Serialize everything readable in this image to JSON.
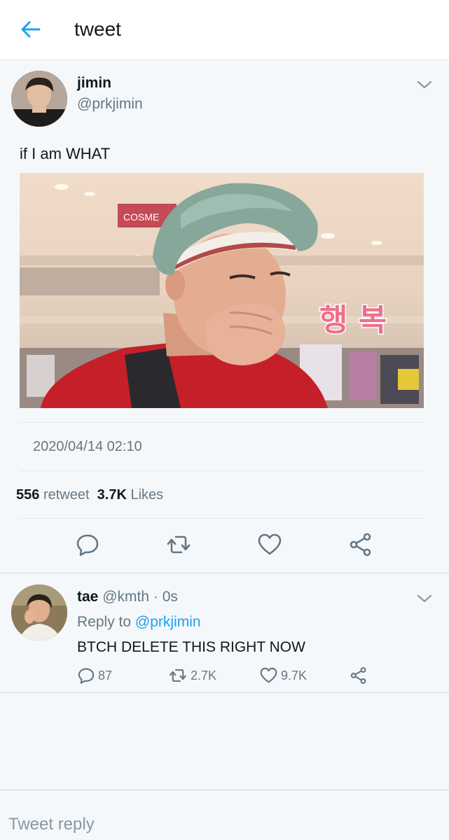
{
  "header": {
    "title": "tweet"
  },
  "tweet": {
    "display_name": "jimin",
    "handle": "@prkjimin",
    "text": "if I am WHAT",
    "media": {
      "sign_text": "COSME",
      "caption": "행 복"
    },
    "timestamp": "2020/04/14 02:10",
    "stats": {
      "retweets": "556",
      "retweets_label": "retweet",
      "likes": "3.7K",
      "likes_label": "Likes"
    }
  },
  "reply": {
    "display_name": "tae",
    "handle": "@kmth",
    "dot": "·",
    "time": "0s",
    "reply_to_label": "Reply to",
    "reply_to_handle": "@prkjimin",
    "text": "BTCH DELETE THIS RIGHT NOW",
    "counts": {
      "replies": "87",
      "retweets": "2.7K",
      "likes": "9.7K"
    }
  },
  "composer": {
    "placeholder": "Tweet reply"
  },
  "colors": {
    "accent": "#1da1f2",
    "secondary_text": "#657786",
    "text": "#14171a",
    "divider": "#e1e8ed"
  },
  "icons": [
    "back-arrow-icon",
    "chevron-down-icon",
    "reply-icon",
    "retweet-icon",
    "heart-icon",
    "share-icon"
  ]
}
